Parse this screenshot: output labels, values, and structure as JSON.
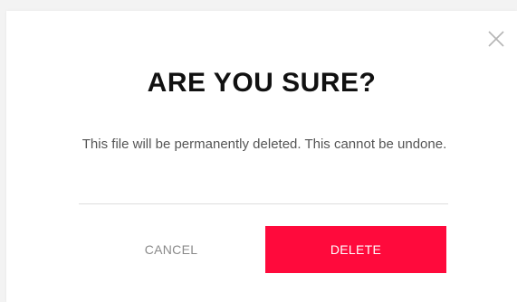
{
  "dialog": {
    "title": "ARE YOU SURE?",
    "message": "This file will be permanently deleted. This cannot be undone.",
    "close_icon": "close-icon",
    "cancel_label": "CANCEL",
    "delete_label": "DELETE"
  },
  "colors": {
    "accent": "#ff0a3c",
    "title": "#111111",
    "message": "#555555",
    "cancel_text": "#8a8a8a",
    "close_icon": "#b5b5b5",
    "divider": "#dddddd"
  }
}
